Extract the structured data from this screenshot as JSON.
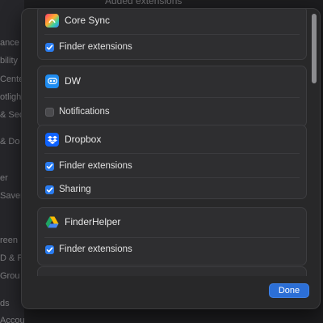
{
  "background": {
    "heading": "Added extensions",
    "sidebar_fragments": [
      "ance",
      "bility",
      "Cente",
      "otligh",
      "& Sec",
      "& Do",
      "er",
      "Saver",
      "reen",
      "D & Pa",
      "Grou",
      "ds",
      "Accounts"
    ]
  },
  "sheet": {
    "groups": [
      {
        "app_name": "Core Sync",
        "icon": "core-sync-icon",
        "options": [
          {
            "label": "Finder extensions",
            "checked": true
          }
        ]
      },
      {
        "app_name": "DW",
        "icon": "dw-icon",
        "options": [
          {
            "label": "Notifications",
            "checked": false
          }
        ]
      },
      {
        "app_name": "Dropbox",
        "icon": "dropbox-icon",
        "options": [
          {
            "label": "Finder extensions",
            "checked": true
          },
          {
            "label": "Sharing",
            "checked": true
          }
        ]
      },
      {
        "app_name": "FinderHelper",
        "icon": "finderhelper-icon",
        "options": [
          {
            "label": "Finder extensions",
            "checked": true
          }
        ]
      }
    ],
    "done_label": "Done"
  },
  "colors": {
    "accent": "#2a7cf0",
    "done_button": "#2c6fd6"
  }
}
